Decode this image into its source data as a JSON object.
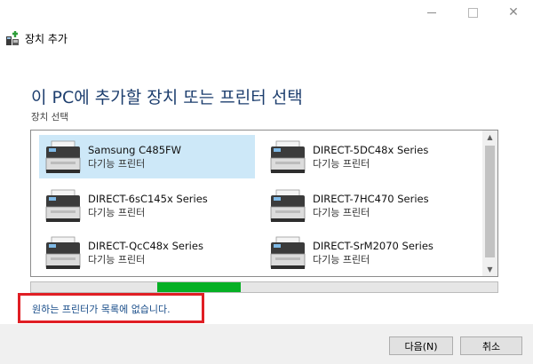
{
  "window": {
    "minimize_icon": "minimize-icon",
    "maximize_icon": "maximize-icon",
    "close_glyph": "✕"
  },
  "header": {
    "title": "장치 추가",
    "icon": "add-device-icon"
  },
  "page": {
    "title": "이 PC에 추가할 장치 또는 프린터 선택",
    "subtitle": "장치 선택"
  },
  "devices": [
    {
      "name": "Samsung C485FW",
      "type": "다기능 프린터",
      "selected": true
    },
    {
      "name": "DIRECT-5DC48x Series",
      "type": "다기능 프린터",
      "selected": false
    },
    {
      "name": "DIRECT-6sC145x Series",
      "type": "다기능 프린터",
      "selected": false
    },
    {
      "name": "DIRECT-7HC470 Series",
      "type": "다기능 프린터",
      "selected": false
    },
    {
      "name": "DIRECT-QcC48x Series",
      "type": "다기능 프린터",
      "selected": false
    },
    {
      "name": "DIRECT-SrM2070 Series",
      "type": "다기능 프린터",
      "selected": false
    }
  ],
  "scrollbar": {
    "up_glyph": "▲",
    "down_glyph": "▼"
  },
  "search_progress": {
    "start": 0.27,
    "end": 0.45,
    "color": "#06b025"
  },
  "missing_printer_link": "원하는 프린터가 목록에 없습니다.",
  "highlight_color": "#e01e24",
  "buttons": {
    "next": "다음(N)",
    "cancel": "취소"
  }
}
